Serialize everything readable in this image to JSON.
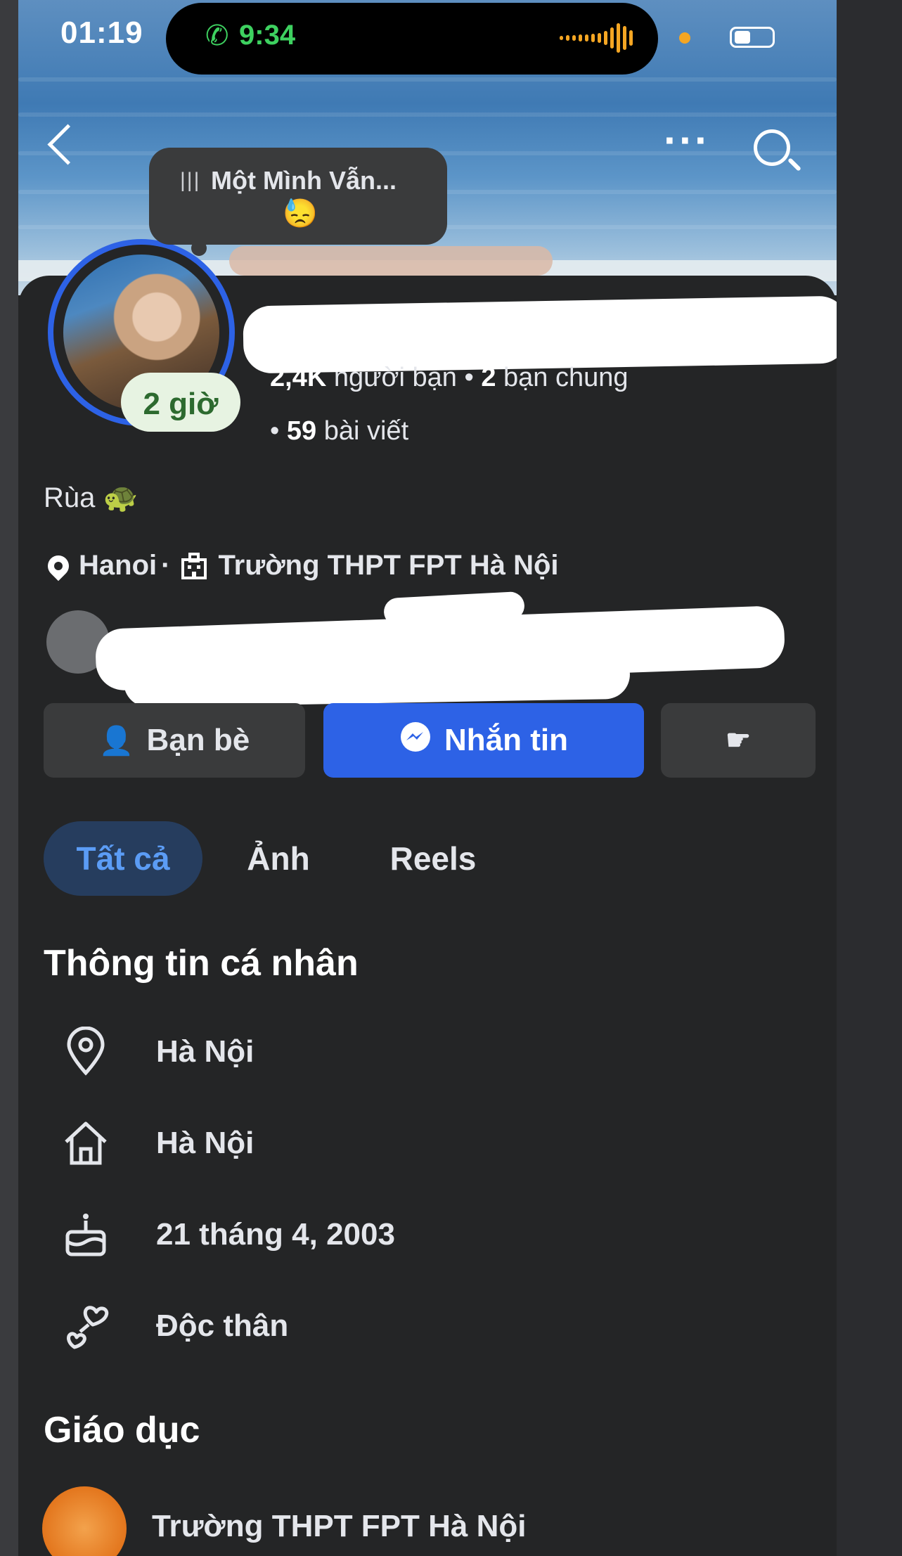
{
  "status_bar": {
    "time": "01:19",
    "call_time": "9:34"
  },
  "note": {
    "title": "Một Mình Vẫn...",
    "emoji": "😓"
  },
  "profile": {
    "active_time": "2 giờ",
    "friends_count": "2,4K",
    "friends_label": "người bạn",
    "mutual_count": "2",
    "mutual_label": "bạn chung",
    "posts_count": "59",
    "posts_label": "bài viết",
    "bio": "Rùa 🐢",
    "location": "Hanoi",
    "school": "Trường THPT FPT Hà Nội"
  },
  "actions": {
    "friends_label": "Bạn bè",
    "message_label": "Nhắn tin"
  },
  "tabs": [
    {
      "label": "Tất cả"
    },
    {
      "label": "Ảnh"
    },
    {
      "label": "Reels"
    }
  ],
  "personal_info": {
    "title": "Thông tin cá nhân",
    "items": [
      {
        "icon": "location-pin-icon",
        "text": "Hà Nội"
      },
      {
        "icon": "home-icon",
        "text": "Hà Nội"
      },
      {
        "icon": "birthday-cake-icon",
        "text": "21 tháng 4, 2003"
      },
      {
        "icon": "hearts-icon",
        "text": "Độc thân"
      }
    ]
  },
  "education": {
    "title": "Giáo dục",
    "school": "Trường THPT FPT Hà Nội"
  },
  "colors": {
    "accent": "#2d62e6",
    "background": "#242526",
    "active_tab_text": "#5b9cf5",
    "time_pill_text": "#2d6a2f"
  }
}
